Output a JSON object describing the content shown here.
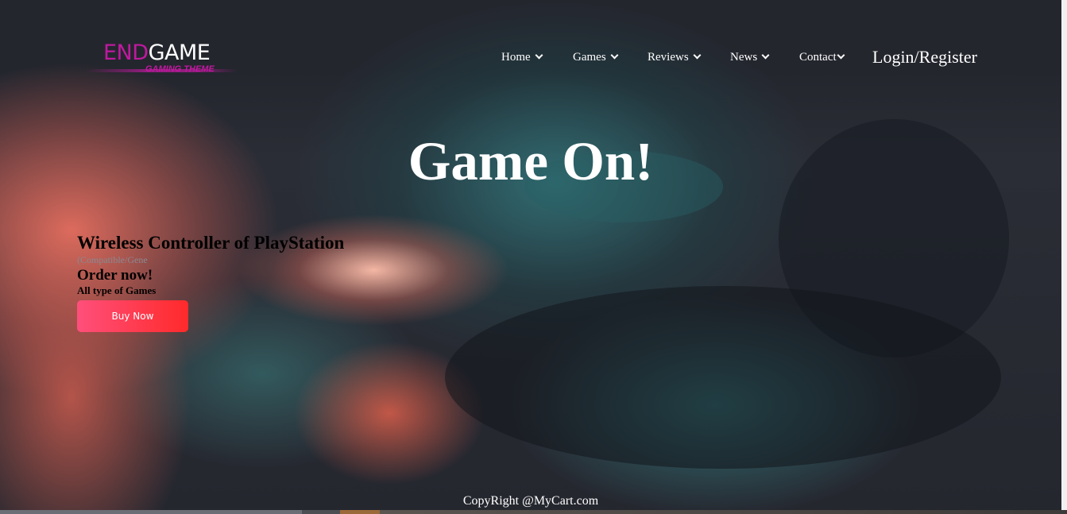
{
  "logo": {
    "main_part1": "END",
    "main_part2": "GAME",
    "tagline": "GAMING THEME"
  },
  "nav": {
    "items": [
      {
        "label": "Home"
      },
      {
        "label": "Games"
      },
      {
        "label": "Reviews"
      },
      {
        "label": "News"
      },
      {
        "label": "Contact"
      }
    ],
    "login_label": "Login/Register"
  },
  "hero": {
    "headline": "Game On!"
  },
  "promo": {
    "title": "Wireless Controller of PlayStation",
    "subtitle": "(Compatible/Gene",
    "order": "Order now!",
    "types": "All type of Games",
    "button_label": "Buy Now"
  },
  "footer": {
    "copyright": "CopyRight @MyCart.com"
  },
  "colors": {
    "brand": "#c0199f",
    "button_start": "#ff4f7b",
    "button_end": "#ff2a2a"
  }
}
